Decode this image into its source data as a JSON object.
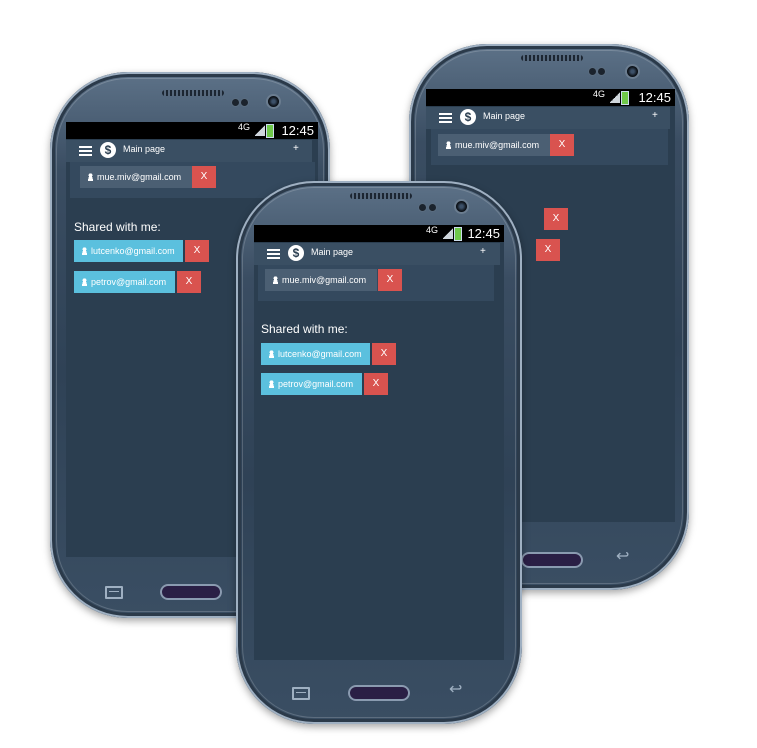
{
  "status": {
    "network": "4G",
    "time": "12:45"
  },
  "nav": {
    "title": "Main page",
    "add_label": "+",
    "logo_symbol": "$"
  },
  "owned": {
    "email": "mue.miv@gmail.com",
    "remove_label": "X"
  },
  "shared": {
    "title": "Shared with me:",
    "items": [
      {
        "email": "lutcenko@gmail.com",
        "remove_label": "X"
      },
      {
        "email": "petrov@gmail.com",
        "remove_label": "X"
      }
    ]
  },
  "colors": {
    "screen_bg": "#2b3e50",
    "nav_bg": "#3a4f63",
    "chip_blue": "#5bc0de",
    "remove_red": "#d9534f"
  },
  "icons": {
    "menu": "hamburger-icon",
    "logo": "dollar-icon",
    "user": "person-icon",
    "add": "plus-icon",
    "home": "home-key-icon",
    "back": "back-icon",
    "menu_key": "menu-key-icon"
  }
}
